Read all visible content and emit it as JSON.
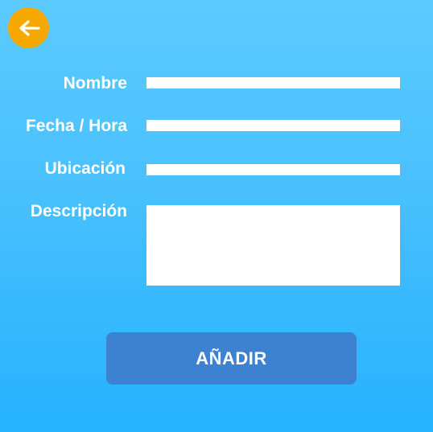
{
  "header": {
    "back_icon": "arrow-left-icon",
    "back_color": "#f6a800"
  },
  "form": {
    "name_label": "Nombre",
    "name_value": "",
    "datetime_label": "Fecha / Hora",
    "datetime_value": "",
    "location_label": "Ubicación",
    "location_value": "",
    "description_label": "Descripción",
    "description_value": ""
  },
  "actions": {
    "add_label": "AÑADIR",
    "add_color": "#3d82d0"
  },
  "theme": {
    "background_top": "#5ccaff",
    "background_bottom": "#25b2ff"
  }
}
